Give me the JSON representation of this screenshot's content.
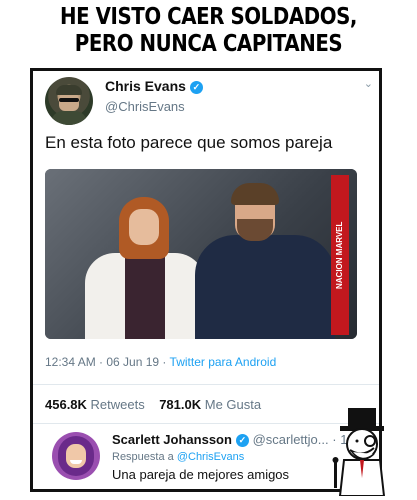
{
  "meme": {
    "line1": "HE VISTO CAER SOLDADOS,",
    "line2": "PERO NUNCA CAPITANES"
  },
  "tweet": {
    "name": "Chris Evans",
    "handle": "@ChrisEvans",
    "text": "En esta foto parece que somos pareja",
    "photo_badge": "NACION MARVEL",
    "time": "12:34 AM · 06 Jun 19 ·",
    "client": "Twitter para Android",
    "retweets_count": "456.8K",
    "retweets_label": "Retweets",
    "likes_count": "781.0K",
    "likes_label": "Me Gusta",
    "menu_icon": "chevron-down-icon"
  },
  "reply": {
    "name": "Scarlett Johansson",
    "handle": "@scarlettjo...",
    "time": "1m",
    "replying_label": "Respuesta a",
    "replying_to": "@ChrisEvans",
    "text": "Una pareja de mejores amigos"
  },
  "colors": {
    "accent": "#1da1f2",
    "secondary_text": "#657786",
    "badge_red": "#c2181e"
  }
}
